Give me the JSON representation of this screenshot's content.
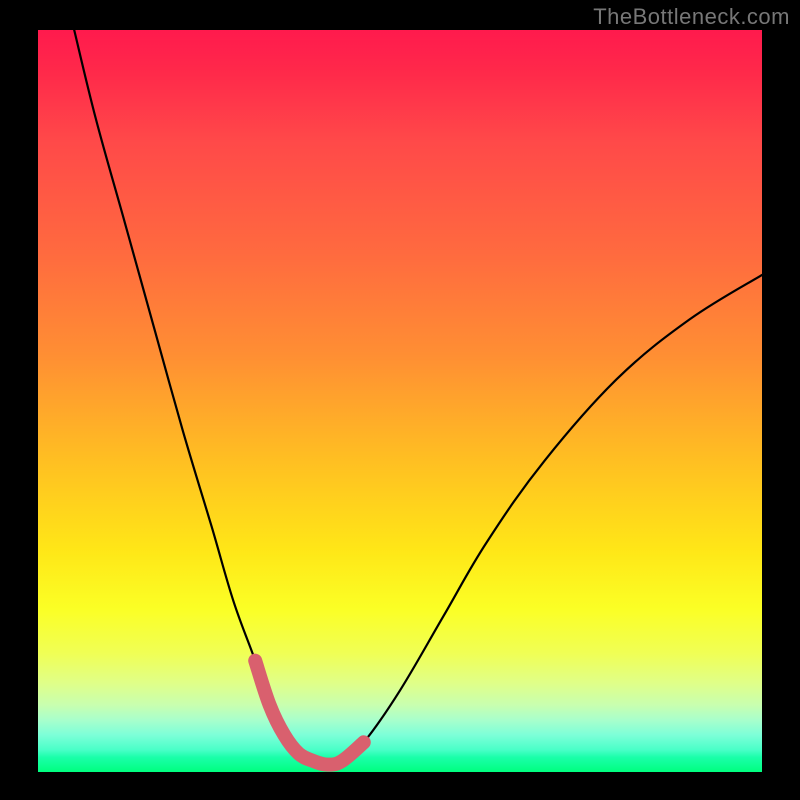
{
  "watermark": "TheBottleneck.com",
  "colors": {
    "gradient_top": "#ff1a4d",
    "gradient_bottom": "#00ff7f",
    "curve": "#000000",
    "markers": "#d9606e",
    "background": "#000000"
  },
  "chart_data": {
    "type": "line",
    "title": "",
    "xlabel": "",
    "ylabel": "",
    "xlim": [
      0,
      100
    ],
    "ylim": [
      0,
      100
    ],
    "grid": false,
    "legend": false,
    "series": [
      {
        "name": "bottleneck_curve",
        "x": [
          5,
          8,
          12,
          16,
          20,
          24,
          27,
          30,
          32,
          34,
          36,
          38,
          40,
          42,
          45,
          50,
          56,
          62,
          70,
          80,
          90,
          100
        ],
        "y": [
          100,
          88,
          74,
          60,
          46,
          33,
          23,
          15,
          9,
          5,
          2.5,
          1.5,
          1,
          1.5,
          4,
          11,
          21,
          31,
          42,
          53,
          61,
          67
        ]
      }
    ],
    "markers": {
      "name": "highlighted_region",
      "x": [
        30,
        32,
        34,
        36,
        38,
        40,
        42,
        45
      ],
      "y": [
        15,
        9,
        5,
        2.5,
        1.5,
        1,
        1.5,
        4
      ]
    },
    "annotations": [
      {
        "text": "TheBottleneck.com",
        "position": "top-right"
      }
    ]
  }
}
